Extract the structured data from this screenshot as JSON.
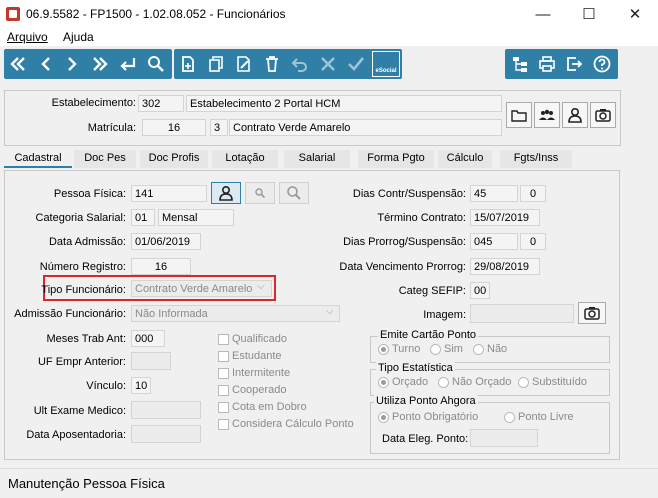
{
  "window": {
    "title": "06.9.5582 - FP1500 - 1.02.08.052 - Funcionários",
    "minimize_glyph": "—",
    "maximize_glyph": "☐",
    "close_glyph": "✕"
  },
  "menu": {
    "arquivo": "Arquivo",
    "ajuda": "Ajuda"
  },
  "toolbar": {
    "nav_icons": [
      "first-record-icon",
      "previous-record-icon",
      "next-record-icon",
      "last-record-icon",
      "return-icon",
      "search-icon"
    ],
    "edit_icons": [
      "new-document-icon",
      "copy-icon",
      "edit-icon",
      "delete-icon",
      "undo-icon",
      "cancel-icon",
      "confirm-icon"
    ],
    "esocial_label": "eSocial",
    "right_icons": [
      "org-tree-icon",
      "print-icon",
      "exit-icon",
      "help-icon"
    ]
  },
  "header": {
    "estabelecimento_label": "Estabelecimento:",
    "estabelecimento_code": "302",
    "estabelecimento_name": "Estabelecimento 2 Portal HCM",
    "matricula_label": "Matrícula:",
    "matricula_value": "16",
    "contrato_code": "3",
    "contrato_name": "Contrato Verde Amarelo"
  },
  "tabs": [
    "Cadastral",
    "Doc Pes",
    "Doc Profis",
    "Lotação",
    "Salarial",
    "Forma Pgto",
    "Cálculo",
    "Fgts/Inss"
  ],
  "form": {
    "pessoa_fisica_label": "Pessoa Física:",
    "pessoa_fisica_value": "141",
    "categoria_salarial_label": "Categoria Salarial:",
    "categoria_salarial_code": "01",
    "categoria_salarial_name": "Mensal",
    "data_admissao_label": "Data Admissão:",
    "data_admissao_value": "01/06/2019",
    "numero_registro_label": "Número Registro:",
    "numero_registro_value": "16",
    "tipo_funcionario_label": "Tipo Funcionário:",
    "tipo_funcionario_value": "Contrato Verde Amarelo",
    "admissao_funcionario_label": "Admissão Funcionário:",
    "admissao_funcionario_value": "Não Informada",
    "meses_trab_ant_label": "Meses Trab Ant:",
    "meses_trab_ant_value": "000",
    "uf_empr_anterior_label": "UF Empr Anterior:",
    "uf_empr_anterior_value": "",
    "vinculo_label": "Vínculo:",
    "vinculo_value": "10",
    "ult_exame_medico_label": "Ult Exame Medico:",
    "ult_exame_medico_value": "",
    "data_aposentadoria_label": "Data Aposentadoria:",
    "data_aposentadoria_value": "",
    "checkboxes": [
      "Qualificado",
      "Estudante",
      "Intermitente",
      "Cooperado",
      "Cota em Dobro",
      "Considera Cálculo Ponto"
    ],
    "dias_contr_label": "Dias Contr/Suspensão:",
    "dias_contr_value1": "45",
    "dias_contr_value2": "0",
    "termino_contrato_label": "Término Contrato:",
    "termino_contrato_value": "15/07/2019",
    "dias_prorrog_label": "Dias Prorrog/Suspensão:",
    "dias_prorrog_value1": "045",
    "dias_prorrog_value2": "0",
    "data_venc_prorrog_label": "Data Vencimento Prorrog:",
    "data_venc_prorrog_value": "29/08/2019",
    "categ_sefip_label": "Categ SEFIP:",
    "categ_sefip_value": "00",
    "imagem_label": "Imagem:",
    "imagem_value": ""
  },
  "emite_cartao_ponto": {
    "title": "Emite Cartão Ponto",
    "options": [
      "Turno",
      "Sim",
      "Não"
    ],
    "selected": "Turno"
  },
  "tipo_estatistica": {
    "title": "Tipo Estatística",
    "options": [
      "Orçado",
      "Não Orçado",
      "Substituído"
    ],
    "selected": "Orçado"
  },
  "ponto_ahgora": {
    "title": "Utiliza Ponto Ahgora",
    "options": [
      "Ponto Obrigatório",
      "Ponto Livre"
    ],
    "selected": "Ponto Obrigatório",
    "data_eleg_label": "Data Eleg. Ponto:",
    "data_eleg_value": ""
  },
  "status": {
    "text": "Manutenção Pessoa Física"
  },
  "colors": {
    "toolbar_blue": "#2f7fa6",
    "highlight_red": "#d9262b",
    "active_tab_underline": "#2f7fa6"
  }
}
